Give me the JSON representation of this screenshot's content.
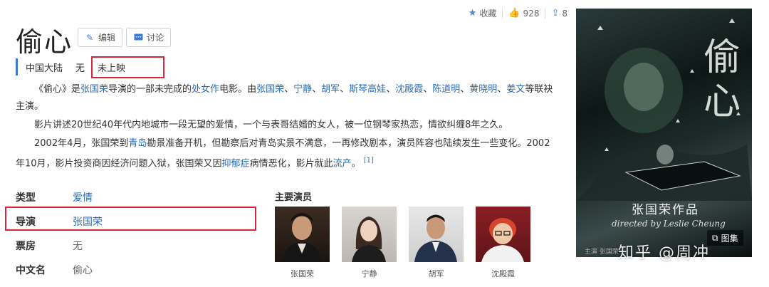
{
  "title": "偷心",
  "buttons": {
    "edit": "编辑",
    "discuss": "讨论"
  },
  "actions": {
    "favorite": "收藏",
    "likes": "928",
    "shares": "8"
  },
  "tags": [
    "中国大陆",
    "无",
    "未上映"
  ],
  "summary": {
    "p1": {
      "t1": "《偷心》是",
      "l1": "张国荣",
      "t2": "导演的一部未完成的",
      "l2": "处女作",
      "t3": "电影。由",
      "l3": "张国荣",
      "l4": "宁静",
      "l5": "胡军",
      "l6": "斯琴高娃",
      "l7": "沈殿霞",
      "l8": "陈道明",
      "l9": "黄晓明",
      "l10": "姜文",
      "t4": "等联袂主演。",
      "sep": "、"
    },
    "p2": "影片讲述20世纪40年代内地城市一段无望的爱情，一个与表哥结婚的女人，被一位钢琴家热恋，情欲纠缠8年之久。",
    "p3": {
      "t1": "2002年4月，张国荣到",
      "l1": "青岛",
      "t2": "勘景准备开机，但勘察后对青岛实景不满意，一再修改剧本，演员阵容也陆续发生一些变化。2002年10月，影片投资商因经济问题入狱，张国荣又因",
      "l2": "抑郁症",
      "t3": "病情恶化，影片就此",
      "l3": "流产",
      "t4": "。",
      "ref": "[1]"
    }
  },
  "info": [
    {
      "key": "类型",
      "value": "爱情"
    },
    {
      "key": "导演",
      "value": "张国荣"
    },
    {
      "key": "票房",
      "value": "无"
    },
    {
      "key": "中文名",
      "value": "偷心"
    }
  ],
  "cast_title": "主要演员",
  "cast": [
    "张国荣",
    "宁静",
    "胡军",
    "沈殿霞"
  ],
  "poster": {
    "title": "偷心",
    "subtitle": "张国荣作品",
    "signature": "directed by Leslie Cheung",
    "credit": "主演 张国荣 ..."
  },
  "gallery_label": "图集",
  "watermark": "知乎 @周冲",
  "colors": {
    "link": "#2b6cb5",
    "highlight_box": "#d9263a",
    "accent": "#3a7bd5"
  }
}
